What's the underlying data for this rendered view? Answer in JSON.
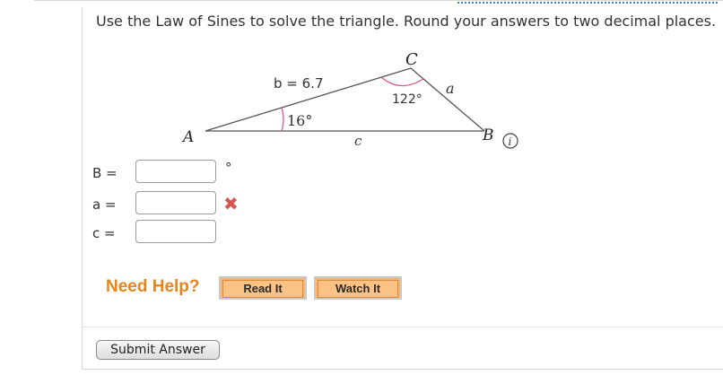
{
  "question": {
    "prompt": "Use the Law of Sines to solve the triangle. Round your answers to two decimal places."
  },
  "figure": {
    "vertex_a": "A",
    "vertex_b": "B",
    "vertex_c": "C",
    "side_b": "b = 6.7",
    "side_a": "a",
    "side_c": "c",
    "angle_a": "16°",
    "angle_c": "122°",
    "info_icon": "i"
  },
  "answers": [
    {
      "label": "B  =",
      "value": "",
      "unit": "°",
      "status": ""
    },
    {
      "label": "a  =",
      "value": "",
      "unit": "",
      "status": "✖"
    },
    {
      "label": "c  =",
      "value": "",
      "unit": "",
      "status": ""
    }
  ],
  "help": {
    "label": "Need Help?",
    "read_it": "Read It",
    "watch_it": "Watch It"
  },
  "submit": {
    "label": "Submit Answer"
  },
  "colors": {
    "help_orange": "#e8851a",
    "button_orange": "#fbb46a",
    "incorrect_red": "#d9534f",
    "angle_arc": "#e0558f"
  }
}
